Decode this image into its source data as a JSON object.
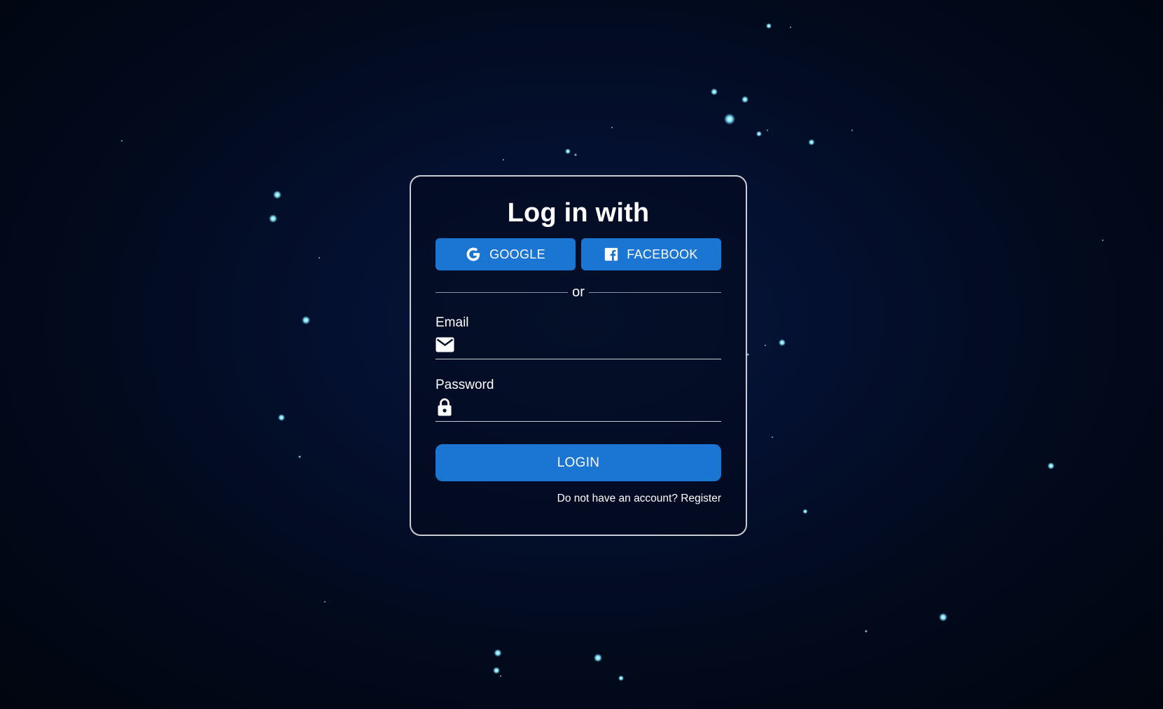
{
  "login": {
    "title": "Log in with",
    "social": {
      "google_label": "GOOGLE",
      "facebook_label": "FACEBOOK"
    },
    "divider_text": "or",
    "email": {
      "label": "Email",
      "value": "",
      "icon": "mail-icon"
    },
    "password": {
      "label": "Password",
      "value": "",
      "icon": "lock-icon"
    },
    "submit_label": "LOGIN",
    "register": {
      "prompt": "Do not have an account?",
      "link_label": "Register"
    }
  },
  "colors": {
    "background": "#020a1d",
    "button": "#1b76d3",
    "card_border": "#c9ccd2",
    "star": "#7fe3ff"
  }
}
